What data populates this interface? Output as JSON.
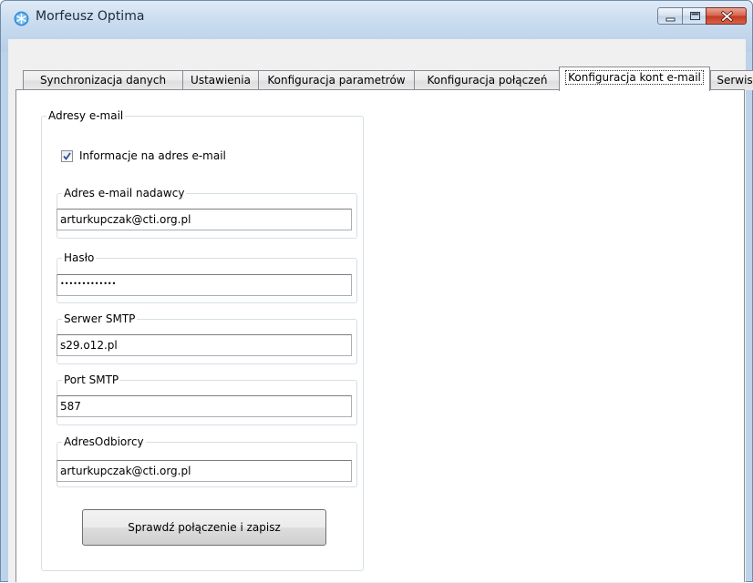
{
  "window": {
    "title": "Morfeusz Optima",
    "icon": "snowflake-app-icon",
    "controls": [
      "minimize-icon",
      "maximize-icon",
      "close-icon"
    ]
  },
  "tabs": [
    {
      "label": "Synchronizacja danych",
      "active": false
    },
    {
      "label": "Ustawienia",
      "active": false
    },
    {
      "label": "Konfiguracja parametrów",
      "active": false
    },
    {
      "label": "Konfiguracja połączeń",
      "active": false
    },
    {
      "label": "Konfiguracja kont e-mail",
      "active": true
    },
    {
      "label": "Serwis",
      "active": false
    }
  ],
  "email_group": {
    "legend": "Adresy e-mail",
    "notify_checkbox": {
      "label": "Informacje na adres e-mail",
      "checked": true
    },
    "sender": {
      "legend": "Adres e-mail nadawcy",
      "value": "arturkupczak@cti.org.pl"
    },
    "password": {
      "legend": "Hasło",
      "value": "•••••••••••••"
    },
    "smtp_server": {
      "legend": "Serwer SMTP",
      "value": "s29.o12.pl"
    },
    "smtp_port": {
      "legend": "Port SMTP",
      "value": "587"
    },
    "recipient": {
      "legend": "AdresOdbiorcy",
      "value": "arturkupczak@cti.org.pl"
    },
    "save_button": "Sprawdź połączenie i zapisz"
  },
  "colors": {
    "titlebar": "#c8dbef",
    "close_button": "#c2381f",
    "group_border": "#d5dfe5"
  }
}
